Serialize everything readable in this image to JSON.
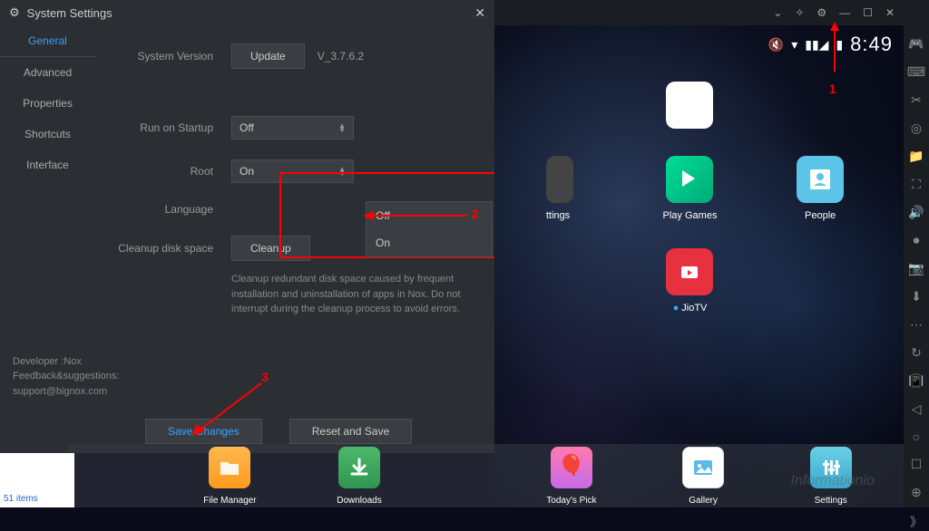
{
  "settings": {
    "title": "System Settings",
    "sidebar": [
      "General",
      "Advanced",
      "Properties",
      "Shortcuts",
      "Interface"
    ],
    "version_label": "System Version",
    "update_btn": "Update",
    "version": "V_3.7.6.2",
    "startup_label": "Run on Startup",
    "startup_value": "Off",
    "root_label": "Root",
    "root_value": "On",
    "dropdown": [
      "Off",
      "On"
    ],
    "language_label": "Language",
    "cleanup_label": "Cleanup disk space",
    "cleanup_btn": "Cleanup",
    "cleanup_desc": "Cleanup redundant disk space caused by frequent installation and uninstallation of apps in Nox. Do not interrupt during the cleanup process to avoid errors.",
    "footer": {
      "dev": "Developer :Nox",
      "fb": "Feedback&suggestions:",
      "email": "support@bignox.com"
    },
    "save_btn": "Save Changes",
    "reset_btn": "Reset and Save"
  },
  "status": {
    "clock": "8:49"
  },
  "apps": {
    "google": "",
    "settings_partial": "ttings",
    "play": "Play Games",
    "people": "People",
    "jio": "JioTV"
  },
  "dock": {
    "fm": "File Manager",
    "dl": "Downloads",
    "pick": "Today's Pick",
    "gallery": "Gallery",
    "settings": "Settings"
  },
  "annotations": {
    "n1": "1",
    "n2": "2",
    "n3": "3"
  },
  "misc": {
    "items": "51 items",
    "watermark": "Informationlo"
  }
}
